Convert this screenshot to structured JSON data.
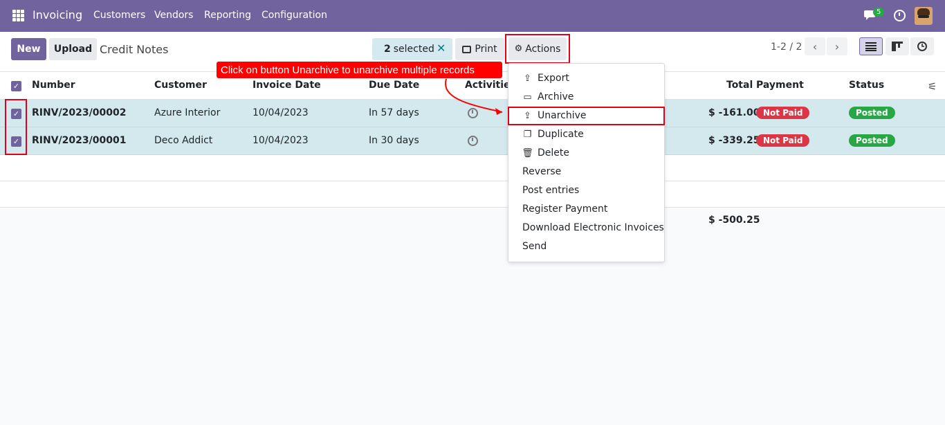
{
  "topbar": {
    "app_name": "Invoicing",
    "menu": [
      "Customers",
      "Vendors",
      "Reporting",
      "Configuration"
    ],
    "chat_badge": "5"
  },
  "control": {
    "new_label": "New",
    "upload_label": "Upload",
    "breadcrumb": "Credit Notes",
    "selected_count": "2",
    "selected_text": "selected",
    "print_label": "Print",
    "actions_label": "Actions",
    "pager": "1-2 / 2"
  },
  "table": {
    "headers": [
      "Number",
      "Customer",
      "Invoice Date",
      "Due Date",
      "Activities",
      "Total",
      "Payment",
      "Status"
    ],
    "rows": [
      {
        "number": "RINV/2023/00002",
        "customer": "Azure Interior",
        "invoice_date": "10/04/2023",
        "due_date": "In 57 days",
        "total": "$ -161.00",
        "payment": "Not Paid",
        "status": "Posted"
      },
      {
        "number": "RINV/2023/00001",
        "customer": "Deco Addict",
        "invoice_date": "10/04/2023",
        "due_date": "In 30 days",
        "total": "$ -339.25",
        "payment": "Not Paid",
        "status": "Posted"
      }
    ],
    "grand_total": "$ -500.25"
  },
  "dropdown": {
    "items": [
      "Export",
      "Archive",
      "Unarchive",
      "Duplicate",
      "Delete",
      "Reverse",
      "Post entries",
      "Register Payment",
      "Download Electronic Invoices",
      "Send"
    ]
  },
  "callout": {
    "text": "Click on button Unarchive to unarchive multiple records"
  },
  "colors": {
    "brand": "#71639e",
    "selected_row": "#d3e9ee",
    "annotation_red": "#ff0000",
    "not_paid": "#dc3545",
    "posted": "#28a745"
  }
}
